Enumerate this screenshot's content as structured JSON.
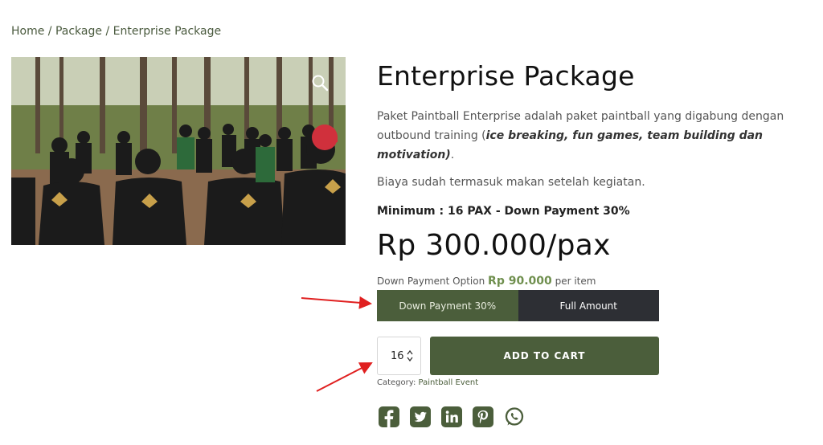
{
  "breadcrumb": {
    "home": "Home",
    "sep1": " / ",
    "package": "Package",
    "sep2": " / ",
    "current": "Enterprise Package"
  },
  "product": {
    "title": "Enterprise Package",
    "desc_main": "Paket Paintball Enterprise adalah paket paintball yang digabung dengan outbound training (",
    "desc_em": "ice breaking, fun games, team building dan motivation)",
    "desc_end": ".",
    "fee_note": "Biaya sudah termasuk makan setelah kegiatan.",
    "minimum": "Minimum : 16 PAX - Down Payment 30%",
    "price": "Rp 300.000/pax"
  },
  "deposit": {
    "label": "Down Payment Option",
    "amount": "Rp 90.000",
    "suffix": "per item",
    "option_dp": "Down Payment 30%",
    "option_full": "Full Amount",
    "selected": "Down Payment 30%"
  },
  "cart": {
    "quantity": "16",
    "button": "ADD TO CART"
  },
  "meta": {
    "category_label": "Category:",
    "category_value": "Paintball Event"
  },
  "social": [
    "facebook-icon",
    "twitter-icon",
    "linkedin-icon",
    "pinterest-icon",
    "whatsapp-icon"
  ],
  "colors": {
    "accent": "#4b5e3b",
    "dark": "#2d2f34",
    "price_green": "#6f8f4e",
    "annotation_arrow": "#e02020"
  }
}
